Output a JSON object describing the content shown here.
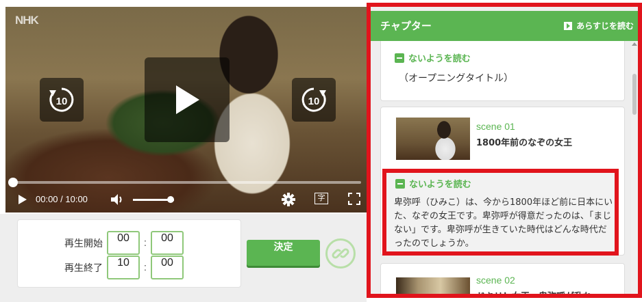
{
  "player": {
    "logo": "NHK",
    "rewind_seconds": "10",
    "forward_seconds": "10",
    "current_time": "00:00",
    "duration": "10:00",
    "time_display": "00:00 / 10:00",
    "captions_label": "字",
    "progress": 0,
    "volume": 0.85
  },
  "time_setting": {
    "start_label": "再生開始",
    "end_label": "再生終了",
    "start_min": "00",
    "start_sec": "00",
    "end_min": "10",
    "end_sec": "00",
    "colon": ":",
    "decide_label": "決定"
  },
  "chapters": {
    "title": "チャプター",
    "summary_link": "あらすじを読む",
    "items": [
      {
        "toggle_label": "ないようを読む",
        "text": "（オープニングタイトル）"
      },
      {
        "scene_no": "scene 01",
        "scene_title": "1800年前のなぞの女王",
        "toggle_label": "ないようを読む",
        "description": "卑弥呼（ひみこ）は、今から1800年ほど前に日本にいた、なぞの女王です。卑弥呼が得意だったのは、「まじない」です。卑弥呼が生きていた時代はどんな時代だったのでしょうか。"
      },
      {
        "scene_no": "scene 02",
        "scene_title": "ドキリ！女王、卑弥呼が乱れ"
      }
    ]
  },
  "colors": {
    "accent_green": "#5bb552",
    "highlight_red": "#e1141c"
  },
  "icons": [
    "play-icon",
    "rewind-10-icon",
    "forward-10-icon",
    "volume-icon",
    "gear-icon",
    "captions-icon",
    "fullscreen-icon",
    "link-icon",
    "minus-icon"
  ]
}
